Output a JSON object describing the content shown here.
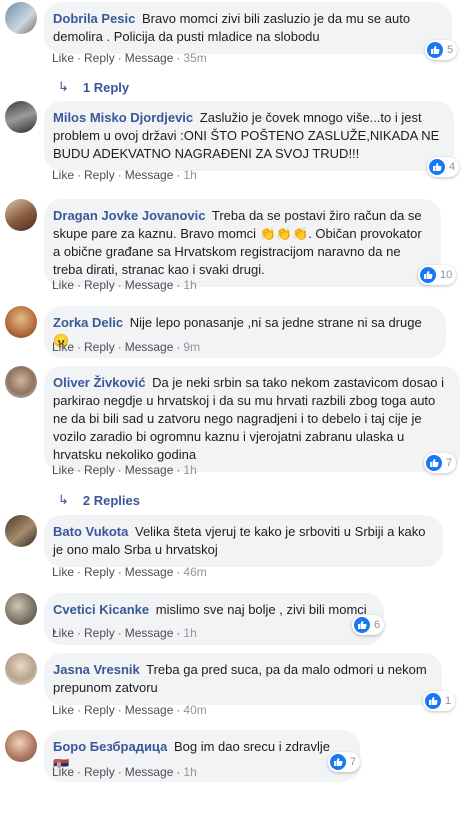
{
  "actions": {
    "like": "Like",
    "reply": "Reply",
    "message": "Message",
    "dot": "·"
  },
  "comments": [
    {
      "name": "Dobrila Pesic",
      "text": "Bravo momci zivi bili zasluzio je da mu se auto demolira . Policija da pusti mladice na slobodu",
      "time": "35m",
      "reactions": "5"
    },
    {
      "name": "Milos Misko Djordjevic",
      "text": "Zaslužio je čovek mnogo više...to i jest problem u ovoj državi :ONI ŠTO POŠTENO ZASLUŽE,NIKADA NE BUDU ADEKVATNO NAGRAĐENI ZA SVOJ TRUD!!!",
      "time": "1h",
      "reactions": "4"
    },
    {
      "name": "Dragan Jovke Jovanovic",
      "text": "Treba da se postavi žiro račun da se skupe pare za kaznu. Bravo momci 👏👏👏. Običan provokator a obične građane sa Hrvatskom registracijom naravno da ne treba dirati, stranac kao i svaki drugi.",
      "time": "1h",
      "reactions": "10"
    },
    {
      "name": "Zorka Delic",
      "text": "Nije lepo ponasanje ,ni sa jedne strane ni sa druge😠",
      "time": "9m",
      "reactions": ""
    },
    {
      "name": "Oliver Živković",
      "text": "Da je neki srbin sa tako nekom zastavicom dosao i parkirao negdje u hrvatskoj i da su mu hrvati razbili zbog toga auto ne da bi bili sad u zatvoru nego nagradjeni i to debelo i taj cije je vozilo zaradio bi ogromnu kaznu i vjerojatni zabranu ulaska u hrvatsku nekoliko godina",
      "time": "1h",
      "reactions": "7"
    },
    {
      "name": "Bato Vukota",
      "text": "Velika šteta vjeruj te kako je srboviti u Srbiji a kako je ono malo Srba u hrvatskoj",
      "time": "46m",
      "reactions": ""
    },
    {
      "name": "Cvetici Kicanke",
      "text": "mislimo sve naj bolje , zivi bili momci ,",
      "time": "1h",
      "reactions": "6"
    },
    {
      "name": "Jasna Vresnik",
      "text": "Treba ga pred suca, pa da malo odmori u nekom prepunom zatvoru",
      "time": "40m",
      "reactions": "1"
    },
    {
      "name": "Боро Безбрадица",
      "text": "Bog im dao srecu i zdravlje 🇷🇸",
      "time": "1h",
      "reactions": "7"
    }
  ],
  "reply_links": {
    "first": "1 Reply",
    "second": "2 Replies"
  },
  "colors": {
    "accent": "#385898",
    "like_blue": "#1877f2",
    "bubble": "#f2f3f5"
  }
}
